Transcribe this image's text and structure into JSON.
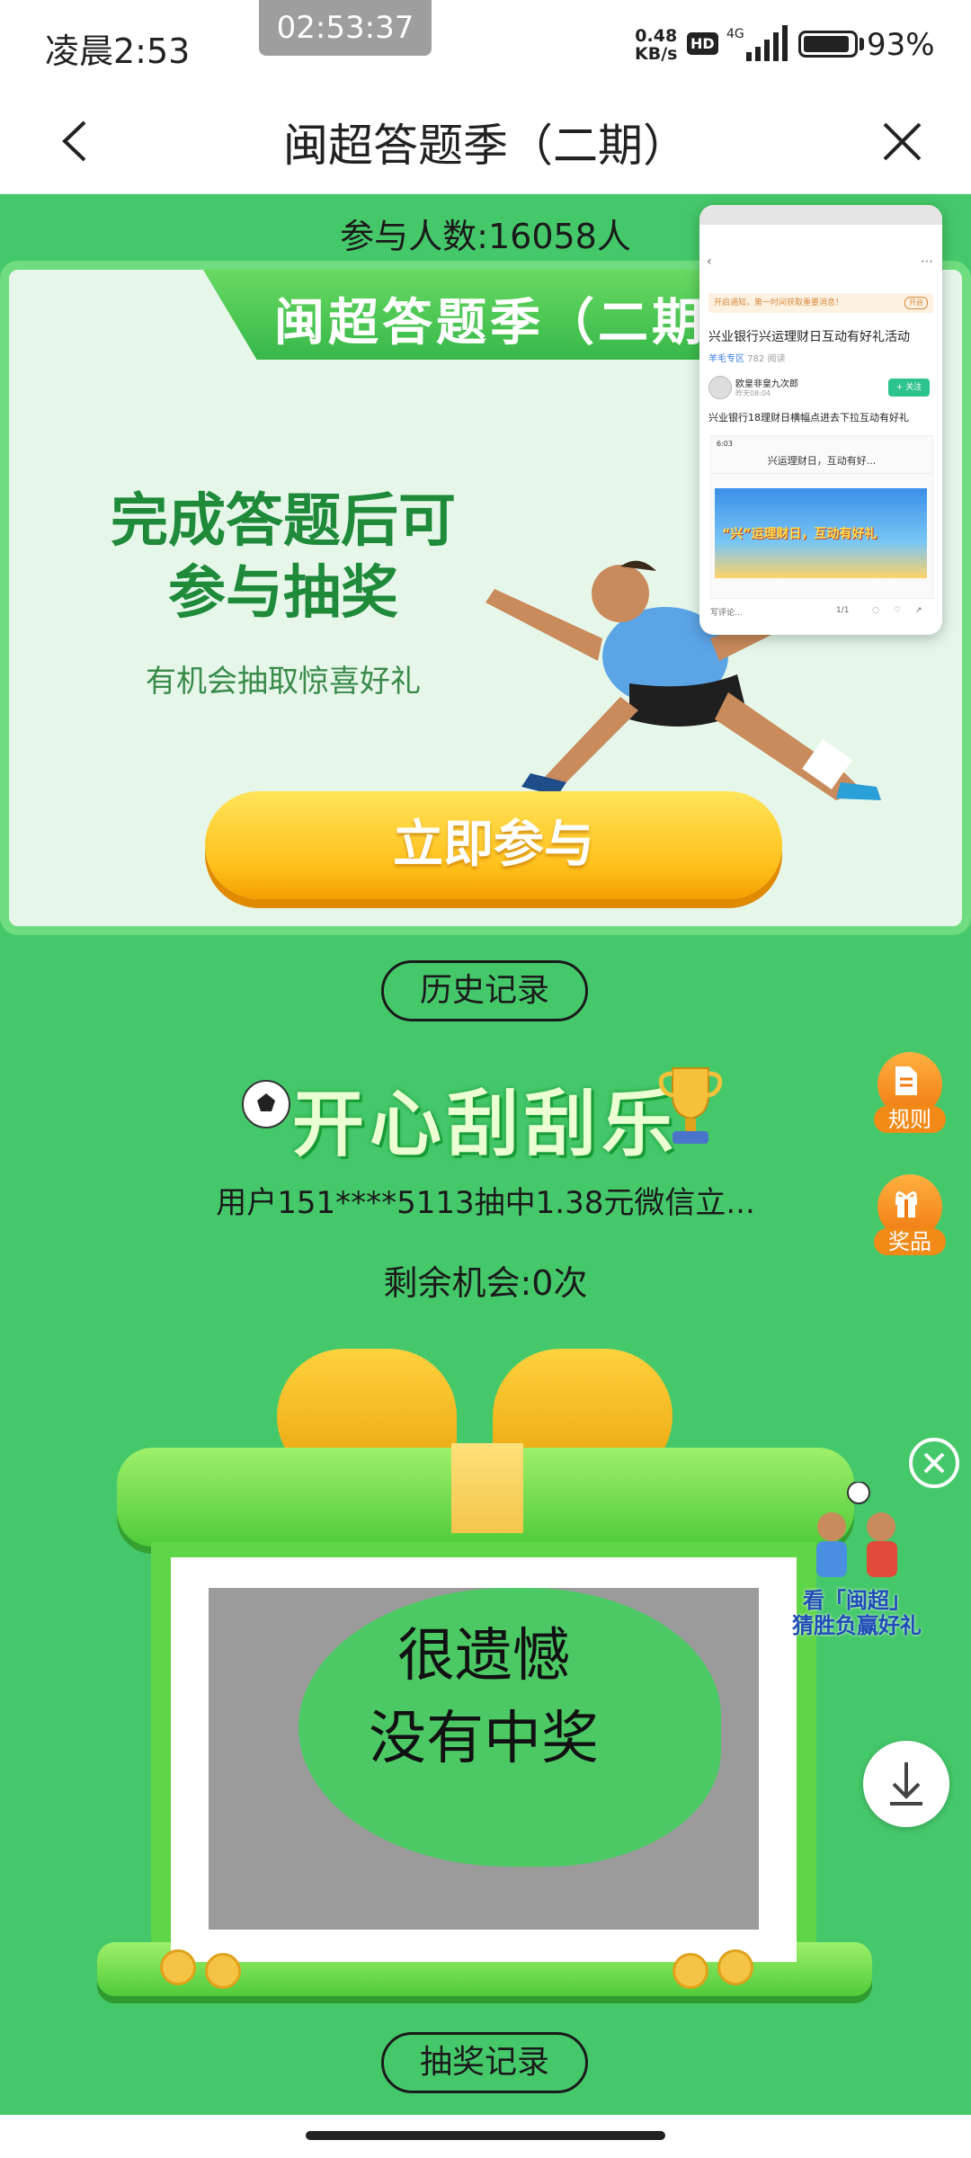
{
  "status_bar": {
    "time": "凌晨2:53",
    "recording_timer": "02:53:37",
    "net_speed_value": "0.48",
    "net_speed_unit": "KB/s",
    "hd_badge": "HD",
    "network_type": "4G",
    "battery_level": 0.93,
    "battery_percent": "93%"
  },
  "nav": {
    "title": "闽超答题季（二期）",
    "back_icon": "chevron-left-icon",
    "close_icon": "close-x-icon"
  },
  "participants": "参与人数:16058人",
  "hero": {
    "banner_title": "闽超答题季（二期",
    "headline": "完成答题后可\n参与抽奖",
    "subline": "有机会抽取惊喜好礼",
    "join_button": "立即参与"
  },
  "pip": {
    "notice": "开启通知，第一时间获取重要消息！",
    "notice_tag": "开启",
    "article_title": "兴业银行兴运理财日互动有好礼活动",
    "section": "羊毛专区",
    "views": "782 阅读",
    "author": "欧皇非皇九次郎",
    "date": "昨天08:04",
    "follow": "+ 关注",
    "first_line": "兴业银行18理财日横幅点进去下拉互动有好礼",
    "shot_status": "6:03",
    "shot_title": "兴运理财日，互动有好...",
    "shot_banner": "“兴”运理财日，互动有好礼",
    "comment_placeholder": "写评论...",
    "page_indicator": "1/1"
  },
  "history_button": "历史记录",
  "side_buttons": [
    {
      "label": "规则",
      "icon": "document-icon"
    },
    {
      "label": "奖品",
      "icon": "gift-icon"
    }
  ],
  "scratch": {
    "title": "开心刮刮乐",
    "winner_ticker": "用户151****5113抽中1.38元微信立...",
    "chances": "剩余机会:0次",
    "result": "很遗憾\n没有中奖"
  },
  "promo": {
    "text": "看「闽超」\n猜胜负赢好礼"
  },
  "lottery_button": "抽奖记录",
  "colors": {
    "page_bg": "#45c86a",
    "hero_green": "#1e8a3a",
    "button_yellow": "#ffc01b",
    "side_orange": "#f28a18"
  }
}
